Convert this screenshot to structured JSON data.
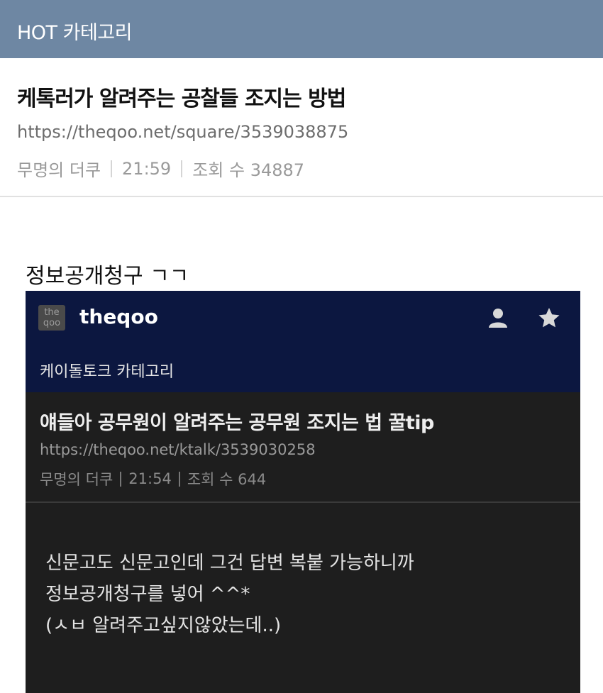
{
  "topbar": {
    "title": "HOT 카테고리"
  },
  "post": {
    "title": "케톡러가 알려주는 공찰들 조지는 방법",
    "url": "https://theqoo.net/square/3539038875",
    "author": "무명의 더쿠",
    "time": "21:59",
    "views": "조회 수 34887"
  },
  "caption": "정보공개청구 ㄱㄱ",
  "embed": {
    "logo_text": "the qoo",
    "brand": "theqoo",
    "category": "케이돌토크 카테고리",
    "title": "얘들아 공무원이 알려주는 공무원 조지는 법 꿀tip",
    "url": "https://theqoo.net/ktalk/3539030258",
    "author": "무명의 더쿠",
    "time": "21:54",
    "views": "조회 수 644",
    "body": [
      "신문고도 신문고인데 그건 답변 복붙 가능하니까",
      "정보공개청구를 넣어 ^^*",
      "(ㅅㅂ 알려주고싶지않았는데..)"
    ]
  },
  "colors": {
    "topbar": "#6e87a3",
    "embed_header": "#0c1740",
    "embed_bg": "#1e1e1e"
  },
  "icons": {
    "user": "user-icon",
    "star": "star-icon"
  }
}
